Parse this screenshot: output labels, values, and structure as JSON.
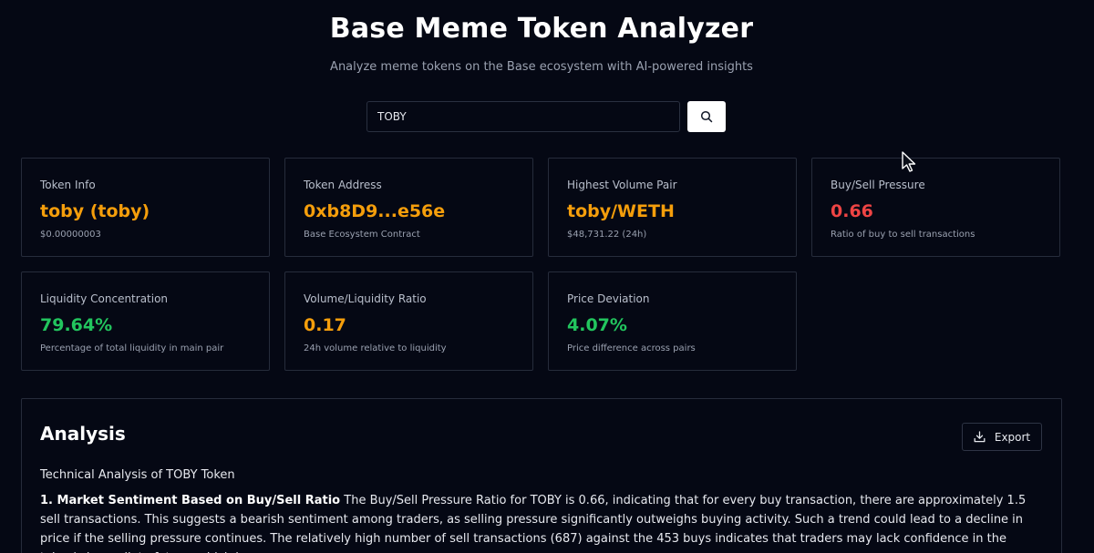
{
  "header": {
    "title": "Base Meme Token Analyzer",
    "subtitle": "Analyze meme tokens on the Base ecosystem with AI-powered insights"
  },
  "search": {
    "value": "TOBY",
    "button_icon": "search-icon"
  },
  "cards": [
    {
      "label": "Token Info",
      "value": "toby (toby)",
      "sub": "$0.00000003",
      "color": "#f59e0b"
    },
    {
      "label": "Token Address",
      "value": "0xb8D9...e56e",
      "sub": "Base Ecosystem Contract",
      "color": "#f59e0b"
    },
    {
      "label": "Highest Volume Pair",
      "value": "toby/WETH",
      "sub": "$48,731.22 (24h)",
      "color": "#f59e0b"
    },
    {
      "label": "Buy/Sell Pressure",
      "value": "0.66",
      "sub": "Ratio of buy to sell transactions",
      "color": "#ef4444"
    },
    {
      "label": "Liquidity Concentration",
      "value": "79.64%",
      "sub": "Percentage of total liquidity in main pair",
      "color": "#22c55e"
    },
    {
      "label": "Volume/Liquidity Ratio",
      "value": "0.17",
      "sub": "24h volume relative to liquidity",
      "color": "#f59e0b"
    },
    {
      "label": "Price Deviation",
      "value": "4.07%",
      "sub": "Price difference across pairs",
      "color": "#22c55e"
    }
  ],
  "analysis": {
    "title": "Analysis",
    "export_label": "Export",
    "export_icon": "download-icon",
    "heading": "Technical Analysis of TOBY Token",
    "section1_title": "1. Market Sentiment Based on Buy/Sell Ratio",
    "section1_text": " The Buy/Sell Pressure Ratio for TOBY is 0.66, indicating that for every buy transaction, there are approximately 1.5 sell transactions. This suggests a bearish sentiment among traders, as selling pressure significantly outweighs buying activity. Such a trend could lead to a decline in price if the selling pressure continues. The relatively high number of sell transactions (687) against the 453 buys indicates that traders may lack confidence in the token's immediate future, which is"
  }
}
